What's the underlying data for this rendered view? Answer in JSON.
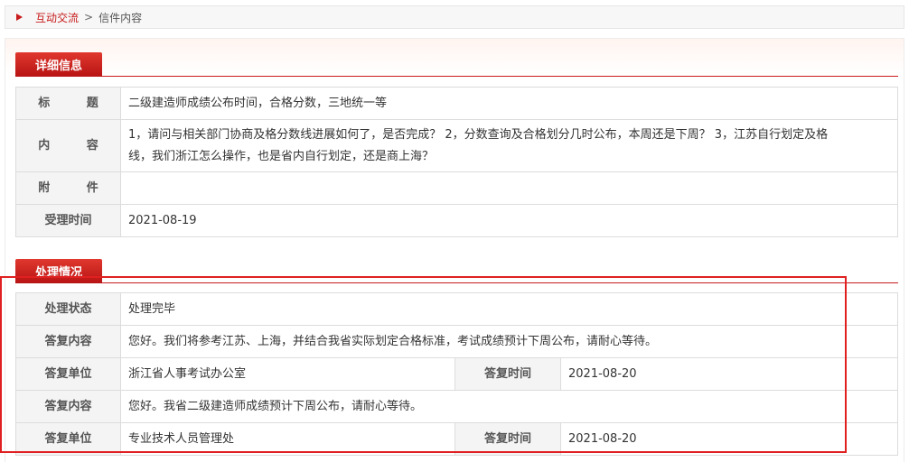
{
  "breadcrumb": {
    "link": "互动交流",
    "sep": ">",
    "current": "信件内容"
  },
  "detail": {
    "heading": "详细信息",
    "rows": {
      "title_label": "标 题",
      "title_value": "二级建造师成绩公布时间，合格分数，三地统一等",
      "content_label": "内 容",
      "content_value_line1": "1，请问与相关部门协商及格分数线进展如何了，是否完成？ 2，分数查询及合格划分几时公布，本周还是下周？ 3，江苏自行划定及格",
      "content_value_line2": "线，我们浙江怎么操作，也是省内自行划定，还是商上海？",
      "attach_label": "附 件",
      "attach_value": "",
      "date_label": "受理时间",
      "date_value": "2021-08-19"
    }
  },
  "handling": {
    "heading": "处理情况",
    "status_label": "处理状态",
    "status_value": "处理完毕",
    "replies": [
      {
        "content_label": "答复内容",
        "content_value": "您好。我们将参考江苏、上海，并结合我省实际划定合格标准，考试成绩预计下周公布，请耐心等待。",
        "unit_label": "答复单位",
        "unit_value": "浙江省人事考试办公室",
        "time_label": "答复时间",
        "time_value": "2021-08-20"
      },
      {
        "content_label": "答复内容",
        "content_value": "您好。我省二级建造师成绩预计下周公布，请耐心等待。",
        "unit_label": "答复单位",
        "unit_value": "专业技术人员管理处",
        "time_label": "答复时间",
        "time_value": "2021-08-20"
      }
    ]
  },
  "colors": {
    "accent": "#c81b1b",
    "highlight": "#e02020"
  }
}
